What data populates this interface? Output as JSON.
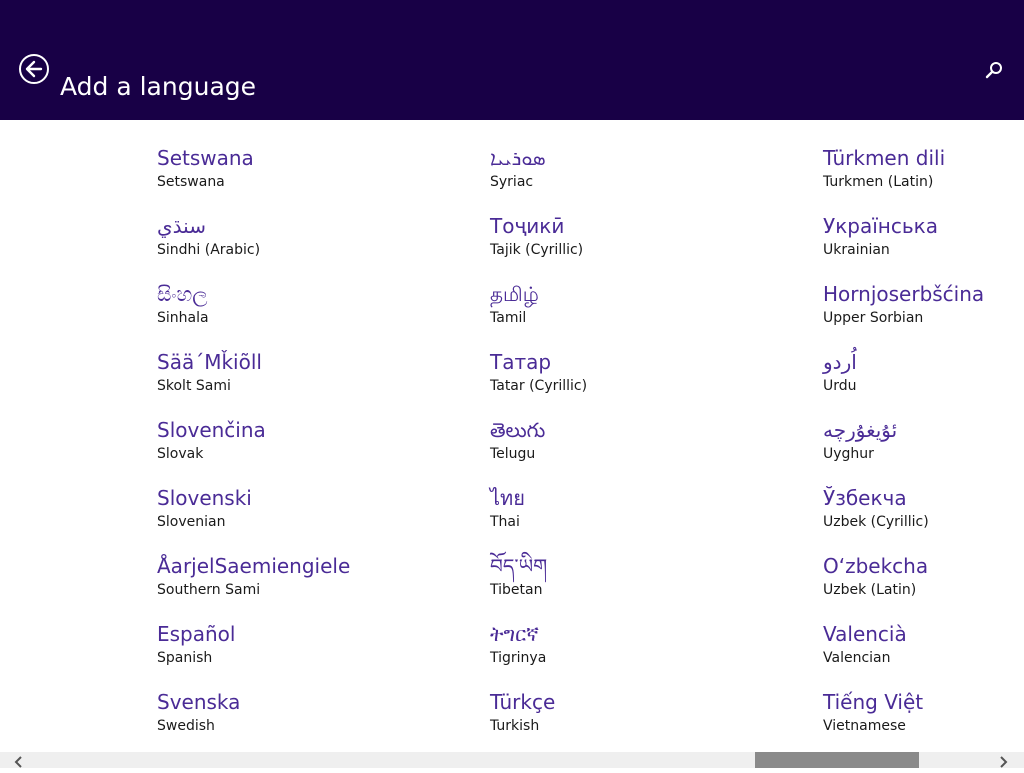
{
  "header": {
    "title": "Add a language",
    "background_color": "#180046",
    "back_icon": "back-arrow-icon",
    "search_icon": "search-icon"
  },
  "accent_color": "#4a2b96",
  "languages": [
    [
      {
        "native": "Setswana",
        "english": "Setswana"
      },
      {
        "native": "سنڌي",
        "english": "Sindhi (Arabic)"
      },
      {
        "native": "සිංහල",
        "english": "Sinhala"
      },
      {
        "native": "Sää´Mǩiõll",
        "english": "Skolt Sami"
      },
      {
        "native": "Slovenčina",
        "english": "Slovak"
      },
      {
        "native": "Slovenski",
        "english": "Slovenian"
      },
      {
        "native": "ÅarjelSaemiengiele",
        "english": "Southern Sami"
      },
      {
        "native": "Español",
        "english": "Spanish"
      },
      {
        "native": "Svenska",
        "english": "Swedish"
      }
    ],
    [
      {
        "native": "ܣܘܪܝܝܐ",
        "english": "Syriac"
      },
      {
        "native": "Тоҷикӣ",
        "english": "Tajik (Cyrillic)"
      },
      {
        "native": "தமிழ்",
        "english": "Tamil"
      },
      {
        "native": "Татар",
        "english": "Tatar (Cyrillic)"
      },
      {
        "native": "తెలుగు",
        "english": "Telugu"
      },
      {
        "native": "ไทย",
        "english": "Thai"
      },
      {
        "native": "བོད་ཡིག",
        "english": "Tibetan"
      },
      {
        "native": "ትግርኛ",
        "english": "Tigrinya"
      },
      {
        "native": "Türkçe",
        "english": "Turkish"
      }
    ],
    [
      {
        "native": "Türkmen dili",
        "english": "Turkmen (Latin)"
      },
      {
        "native": "Українська",
        "english": "Ukrainian"
      },
      {
        "native": "Hornjoserbšćina",
        "english": "Upper Sorbian"
      },
      {
        "native": "اُردو",
        "english": "Urdu"
      },
      {
        "native": "ئۇيغۇرچە",
        "english": "Uyghur"
      },
      {
        "native": "Ўзбекча",
        "english": "Uzbek (Cyrillic)"
      },
      {
        "native": "O‘zbekcha",
        "english": "Uzbek (Latin)"
      },
      {
        "native": "Valencià",
        "english": "Valencian"
      },
      {
        "native": "Tiếng Việt",
        "english": "Vietnamese"
      }
    ]
  ],
  "scrollbar": {
    "left_icon": "chevron-left-icon",
    "right_icon": "chevron-right-icon",
    "position_fraction": 0.78
  }
}
